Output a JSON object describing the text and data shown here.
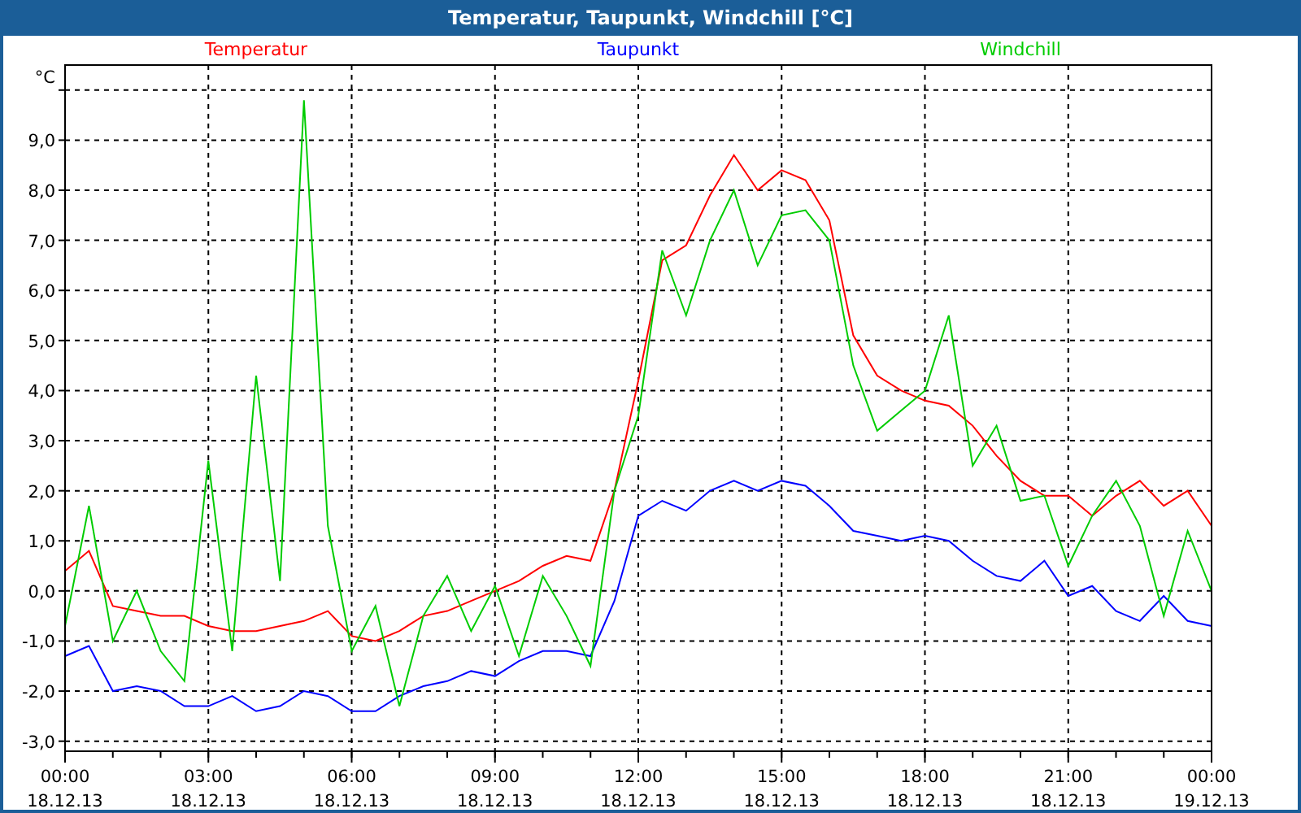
{
  "window": {
    "title": "Temperatur, Taupunkt, Windchill [°C]"
  },
  "chart": {
    "chart_data": {
      "type": "line",
      "ylabel": "°C",
      "categories": [
        "00:00\n18.12.13",
        null,
        null,
        null,
        null,
        null,
        "03:00\n18.12.13",
        null,
        null,
        null,
        null,
        null,
        "06:00\n18.12.13",
        null,
        null,
        null,
        null,
        null,
        "09:00\n18.12.13",
        null,
        null,
        null,
        null,
        null,
        "12:00\n18.12.13",
        null,
        null,
        null,
        null,
        null,
        "15:00\n18.12.13",
        null,
        null,
        null,
        null,
        null,
        "18:00\n18.12.13",
        null,
        null,
        null,
        null,
        null,
        "21:00\n18.12.13",
        null,
        null,
        null,
        null,
        null,
        "00:00\n19.12.13"
      ],
      "series": [
        {
          "name": "Temperatur",
          "color": "#ff0000",
          "values": [
            0.4,
            0.8,
            -0.3,
            -0.4,
            -0.5,
            -0.5,
            -0.7,
            -0.8,
            -0.8,
            -0.7,
            -0.6,
            -0.4,
            -0.9,
            -1.0,
            -0.8,
            -0.5,
            -0.4,
            -0.2,
            0.0,
            0.2,
            0.5,
            0.7,
            0.6,
            2.0,
            4.2,
            6.6,
            6.9,
            7.9,
            8.7,
            8.0,
            8.4,
            8.2,
            7.4,
            5.1,
            4.3,
            4.0,
            3.8,
            3.7,
            3.3,
            2.7,
            2.2,
            1.9,
            1.9,
            1.5,
            1.9,
            2.2,
            1.7,
            2.0,
            1.3
          ]
        },
        {
          "name": "Taupunkt",
          "color": "#0000ff",
          "values": [
            -1.3,
            -1.1,
            -2.0,
            -1.9,
            -2.0,
            -2.3,
            -2.3,
            -2.1,
            -2.4,
            -2.3,
            -2.0,
            -2.1,
            -2.4,
            -2.4,
            -2.1,
            -1.9,
            -1.8,
            -1.6,
            -1.7,
            -1.4,
            -1.2,
            -1.2,
            -1.3,
            -0.2,
            1.5,
            1.8,
            1.6,
            2.0,
            2.2,
            2.0,
            2.2,
            2.1,
            1.7,
            1.2,
            1.1,
            1.0,
            1.1,
            1.0,
            0.6,
            0.3,
            0.2,
            0.6,
            -0.1,
            0.1,
            -0.4,
            -0.6,
            -0.1,
            -0.6,
            -0.7
          ]
        },
        {
          "name": "Windchill",
          "color": "#00cc00",
          "values": [
            -0.7,
            1.7,
            -1.0,
            0.0,
            -1.2,
            -1.8,
            2.6,
            -1.2,
            4.3,
            0.2,
            9.8,
            1.3,
            -1.2,
            -0.3,
            -2.3,
            -0.5,
            0.3,
            -0.8,
            0.1,
            -1.3,
            0.3,
            -0.5,
            -1.5,
            2.0,
            3.5,
            6.8,
            5.5,
            7.0,
            8.0,
            6.5,
            7.5,
            7.6,
            7.0,
            4.5,
            3.2,
            3.6,
            4.0,
            5.5,
            2.5,
            3.3,
            1.8,
            1.9,
            0.5,
            1.5,
            2.2,
            1.3,
            -0.5,
            1.2,
            0.0
          ]
        }
      ],
      "ylim": [
        -3.2,
        10.5
      ],
      "grid": true,
      "yticks": [
        {
          "value": -3,
          "label": "-3,0"
        },
        {
          "value": -2,
          "label": "-2,0"
        },
        {
          "value": -1,
          "label": "-1,0"
        },
        {
          "value": 0,
          "label": "0,0"
        },
        {
          "value": 1,
          "label": "1,0"
        },
        {
          "value": 2,
          "label": "2,0"
        },
        {
          "value": 3,
          "label": "3,0"
        },
        {
          "value": 4,
          "label": "4,0"
        },
        {
          "value": 5,
          "label": "5,0"
        },
        {
          "value": 6,
          "label": "6,0"
        },
        {
          "value": 7,
          "label": "7,0"
        },
        {
          "value": 8,
          "label": "8,0"
        },
        {
          "value": 9,
          "label": "9,0"
        }
      ]
    }
  }
}
